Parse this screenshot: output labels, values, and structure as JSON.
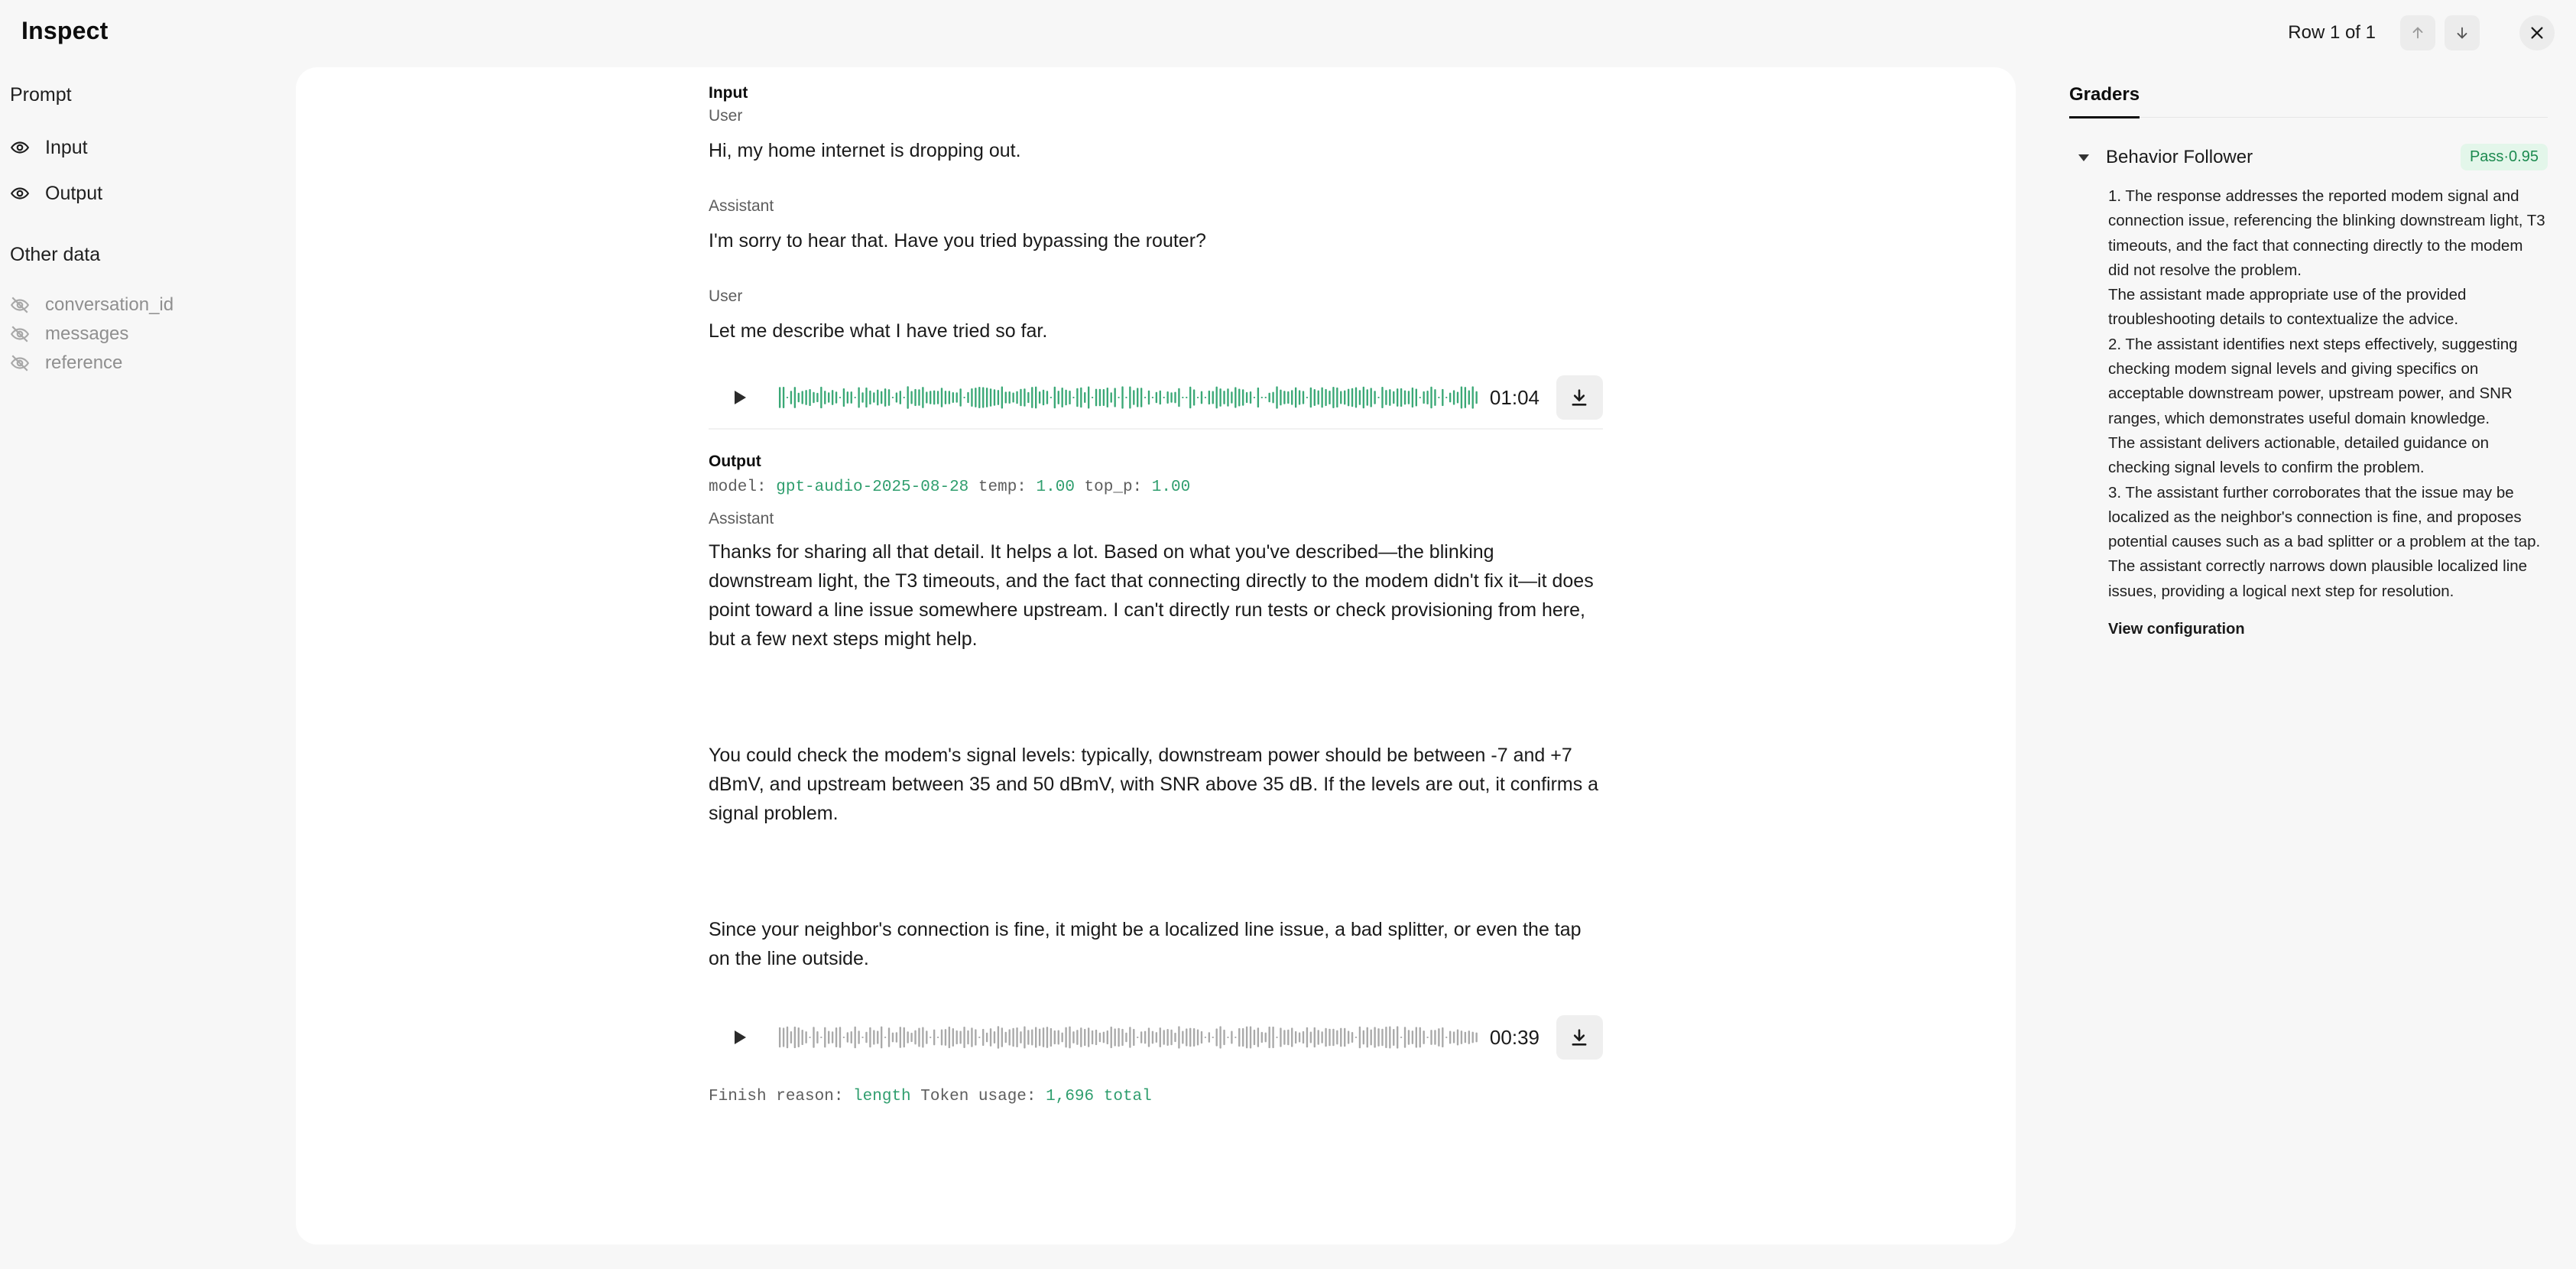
{
  "header": {
    "title": "Inspect",
    "row_label": "Row 1 of 1"
  },
  "sidebar": {
    "prompt_heading": "Prompt",
    "prompt_items": [
      {
        "label": "Input",
        "icon": "eye-icon"
      },
      {
        "label": "Output",
        "icon": "eye-icon"
      }
    ],
    "other_heading": "Other data",
    "other_items": [
      {
        "label": "conversation_id",
        "icon": "eye-off-icon"
      },
      {
        "label": "messages",
        "icon": "eye-off-icon"
      },
      {
        "label": "reference",
        "icon": "eye-off-icon"
      }
    ]
  },
  "input": {
    "title": "Input",
    "messages": [
      {
        "role": "User",
        "text": "Hi, my home internet is dropping out."
      },
      {
        "role": "Assistant",
        "text": "I'm sorry to hear that. Have you tried bypassing the router?"
      },
      {
        "role": "User",
        "text": "Let me describe what I have tried so far."
      }
    ],
    "audio": {
      "duration": "01:04",
      "color": "#3aa876"
    }
  },
  "output": {
    "title": "Output",
    "meta": {
      "model_label": "model:",
      "model": "gpt-audio-2025-08-28",
      "temp_label": "temp:",
      "temp": "1.00",
      "top_p_label": "top_p:",
      "top_p": "1.00"
    },
    "role": "Assistant",
    "paragraphs": [
      "Thanks for sharing all that detail. It helps a lot. Based on what you've described—the blinking downstream light, the T3 timeouts, and the fact that connecting directly to the modem didn't fix it—it does point toward a line issue somewhere upstream. I can't directly run tests or check provisioning from here, but a few next steps might help.",
      "You could check the modem's signal levels: typically, downstream power should be between -7 and +7 dBmV, and upstream between 35 and 50 dBmV, with SNR above 35 dB. If the levels are out, it confirms a signal problem.",
      "Since your neighbor's connection is fine, it might be a localized line issue, a bad splitter, or even the tap on the line outside."
    ],
    "audio": {
      "duration": "00:39",
      "color": "#a9a9a9"
    },
    "footer": {
      "finish_label": "Finish reason:",
      "finish": "length",
      "token_label": "Token usage:",
      "token": "1,696 total"
    }
  },
  "graders": {
    "tab": "Graders",
    "items": [
      {
        "name": "Behavior Follower",
        "badge": "Pass·0.95",
        "lines": [
          "1. The response addresses the reported modem signal and connection issue, referencing the blinking downstream light, T3 timeouts, and the fact that connecting directly to the modem did not resolve the problem.",
          "The assistant made appropriate use of the provided troubleshooting details to contextualize the advice.",
          "2. The assistant identifies next steps effectively, suggesting checking modem signal levels and giving specifics on acceptable downstream power, upstream power, and SNR ranges, which demonstrates useful domain knowledge.",
          "The assistant delivers actionable, detailed guidance on checking signal levels to confirm the problem.",
          "3. The assistant further corroborates that the issue may be localized as the neighbor's connection is fine, and proposes potential causes such as a bad splitter or a problem at the tap.",
          "The assistant correctly narrows down plausible localized line issues, providing a logical next step for resolution."
        ],
        "link": "View configuration"
      }
    ]
  }
}
